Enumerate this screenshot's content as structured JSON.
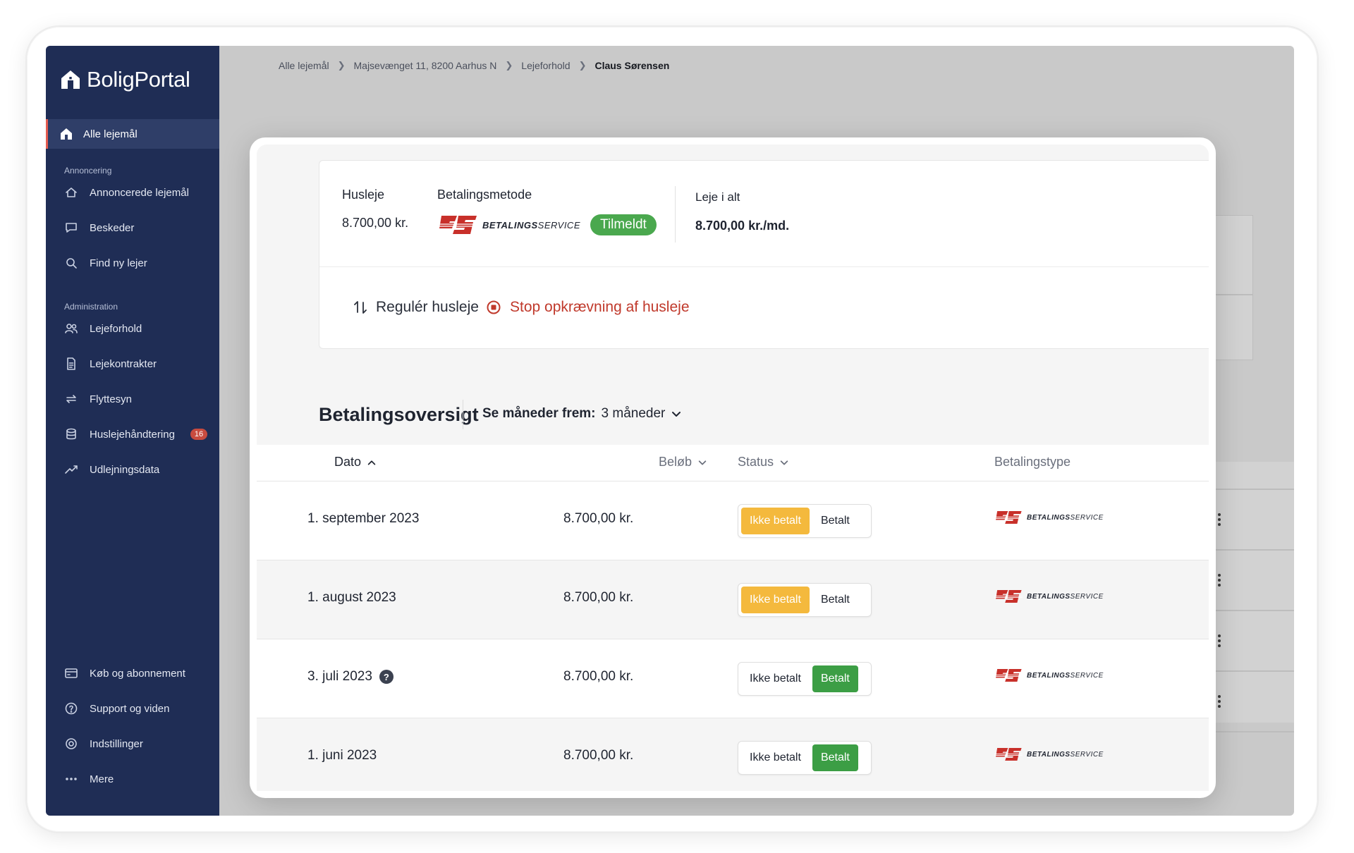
{
  "app": {
    "brand": "BoligPortal"
  },
  "sidebar": {
    "active_item": "Alle lejemål",
    "section_annoncering": "Annoncering",
    "annoncering_items": [
      "Annoncerede lejemål",
      "Beskeder",
      "Find ny lejer"
    ],
    "section_administration": "Administration",
    "administration_items": [
      "Lejeforhold",
      "Lejekontrakter",
      "Flyttesyn",
      "Huslejehåndtering",
      "Udlejningsdata"
    ],
    "badge_count": "16",
    "bottom_items": [
      "Køb og abonnement",
      "Support og viden",
      "Indstillinger",
      "Mere"
    ]
  },
  "breadcrumb": {
    "items": [
      "Alle lejemål",
      "Majsevænget 11, 8200 Aarhus N",
      "Lejeforhold"
    ],
    "current": "Claus Sørensen"
  },
  "rent_card": {
    "rent_label": "Husleje",
    "rent_value": "8.700,00 kr.",
    "method_label": "Betalingsmetode",
    "method_logo_text_bold": "BETALINGS",
    "method_logo_text_thin": "SERVICE",
    "method_status": "Tilmeldt",
    "total_label": "Leje i alt",
    "total_value": "8.700,00 kr./md.",
    "action_adjust": "Regulér husleje",
    "action_stop": "Stop opkrævning af husleje"
  },
  "overview": {
    "title": "Betalingsoversigt",
    "filter_label": "Se måneder frem:",
    "filter_value": "3 måneder",
    "columns": {
      "date": "Dato",
      "amount": "Beløb",
      "status": "Status",
      "payment_type": "Betalingstype"
    },
    "status_unpaid": "Ikke betalt",
    "status_paid": "Betalt",
    "rows": [
      {
        "date": "1. september 2023",
        "amount": "8.700,00 kr.",
        "state": "unpaid",
        "help": false
      },
      {
        "date": "1. august 2023",
        "amount": "8.700,00 kr.",
        "state": "unpaid",
        "help": false
      },
      {
        "date": "3. juli 2023",
        "amount": "8.700,00 kr.",
        "state": "paid",
        "help": true
      },
      {
        "date": "1. juni 2023",
        "amount": "8.700,00 kr.",
        "state": "paid",
        "help": false
      }
    ]
  },
  "colors": {
    "sidebar": "#1f2d55",
    "danger": "#c0392b",
    "paid": "#3c9e45",
    "unpaid": "#f4b93d",
    "enrolled": "#4aa84e",
    "bs_red": "#c8302a"
  }
}
